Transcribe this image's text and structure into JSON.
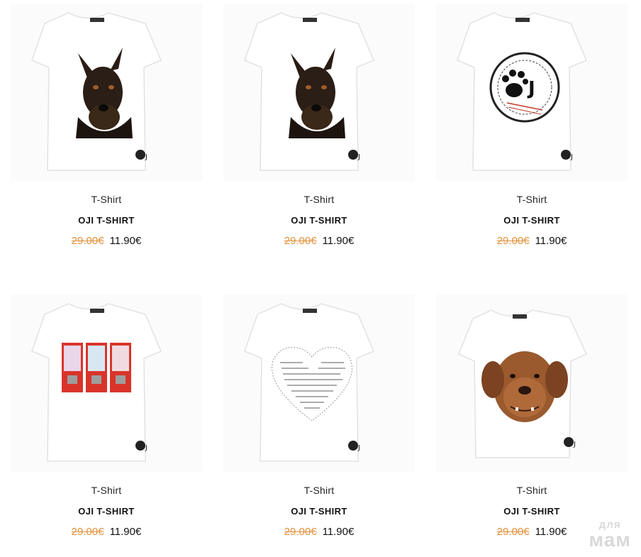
{
  "products": [
    {
      "category": "T-Shirt",
      "name": "OJI T-SHIRT",
      "old_price": "29.00€",
      "price": "11.90€",
      "print": "doberman-print"
    },
    {
      "category": "T-Shirt",
      "name": "OJI T-SHIRT",
      "old_price": "29.00€",
      "price": "11.90€",
      "print": "doberman-print"
    },
    {
      "category": "T-Shirt",
      "name": "OJI T-SHIRT",
      "old_price": "29.00€",
      "price": "11.90€",
      "print": "paw-stamp-print"
    },
    {
      "category": "T-Shirt",
      "name": "OJI T-SHIRT",
      "old_price": "29.00€",
      "price": "11.90€",
      "print": "gumball-machines-print"
    },
    {
      "category": "T-Shirt",
      "name": "OJI T-SHIRT",
      "old_price": "29.00€",
      "price": "11.90€",
      "print": "word-heart-print"
    },
    {
      "category": "T-Shirt",
      "name": "OJI T-SHIRT",
      "old_price": "29.00€",
      "price": "11.90€",
      "print": "mastiff-print"
    }
  ],
  "watermark": {
    "top": "для",
    "bottom": "мам"
  },
  "colors": {
    "old_price": "#e2913a",
    "accent": "#111111"
  }
}
